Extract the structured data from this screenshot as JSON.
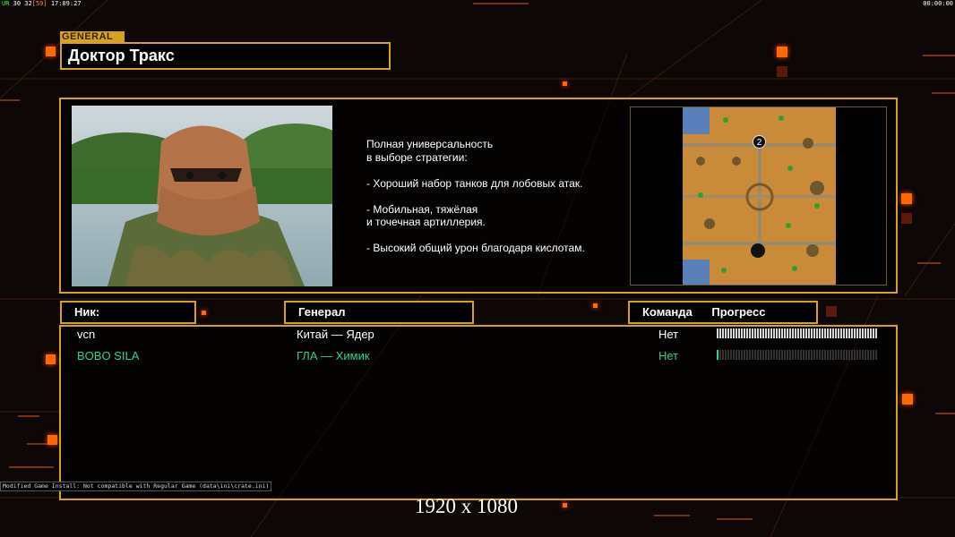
{
  "hud": {
    "top_left_fps_label": "UR",
    "top_left_fps_values": "30 32",
    "top_left_bracket": "[59]",
    "top_left_time": "17:09:27",
    "top_right_time": "00:00:00",
    "bottom_note": "Modified Game Install: Not compatible with Regular Game (data\\ini\\crate.ini)"
  },
  "general": {
    "section_label": "GENERAL",
    "name": "Доктор Тракс",
    "description_lines": [
      "Полная универсальность",
      "в выборе стратегии:",
      "",
      "- Хороший набор танков для лобовых атак.",
      "",
      "- Мобильная, тяжёлая",
      "и точечная артиллерия.",
      "",
      "- Высокий общий урон благодаря кислотам."
    ],
    "portrait_icon": "masked-soldier-portrait",
    "map_icon": "desert-minimap",
    "map_start_marker": "2"
  },
  "table": {
    "headers": {
      "nick": "Ник:",
      "general": "Генерал",
      "team": "Команда",
      "progress": "Прогресс"
    },
    "players": [
      {
        "nick": "vcn",
        "general": "Китай — Ядер",
        "team": "Нет",
        "progress": 1.0,
        "color": "#ffffff"
      },
      {
        "nick": "BOBO  SILA",
        "general": "ГЛА — Химик",
        "team": "Нет",
        "progress": 0.02,
        "color": "#2fd28a"
      }
    ]
  },
  "overlay": {
    "resolution_caption": "1920 x 1080"
  },
  "colors": {
    "accent": "#d6a21b",
    "background": "#0d0705",
    "glow": "#ff6a00"
  }
}
